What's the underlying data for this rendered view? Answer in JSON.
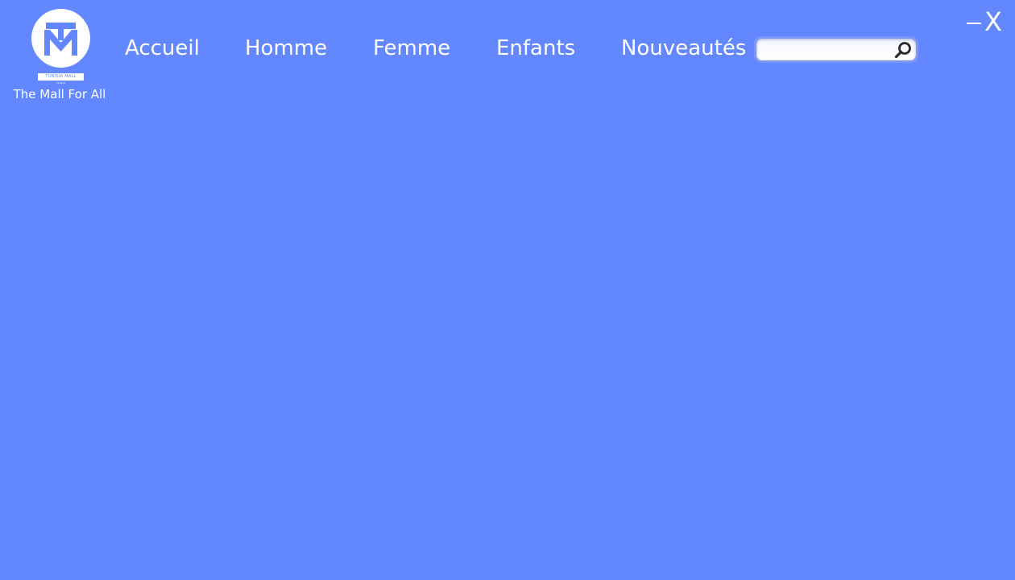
{
  "brand": {
    "wordmark": "TUNISIA MALL",
    "subword": "TUNIS",
    "tagline": "The Mall For All"
  },
  "nav": {
    "items": [
      {
        "label": "Accueil"
      },
      {
        "label": "Homme"
      },
      {
        "label": "Femme"
      },
      {
        "label": "Enfants"
      },
      {
        "label": "Nouveautés"
      }
    ]
  },
  "search": {
    "value": "",
    "placeholder": "",
    "icon": "search-icon"
  },
  "window": {
    "minimize_icon": "minimize-icon",
    "close_label": "X"
  },
  "colors": {
    "background": "#6387FF",
    "text": "#FFFFFF"
  }
}
